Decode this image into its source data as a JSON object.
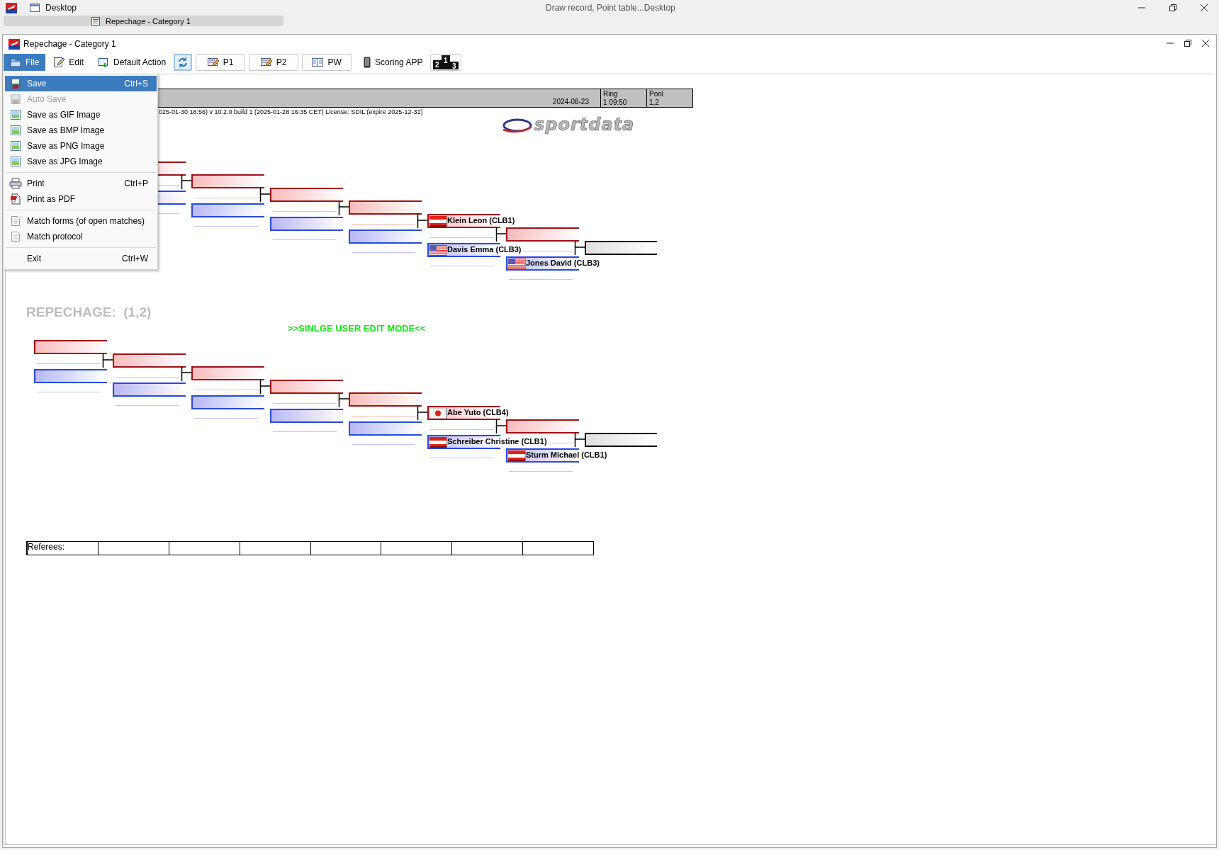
{
  "os_bar": {
    "desktop_label": "Desktop",
    "tab_label": "Repechage - Category 1",
    "center_title": "Draw record, Point table...Desktop"
  },
  "window": {
    "title": "Repechage - Category 1"
  },
  "toolbar": [
    {
      "kind": "menu",
      "label": "File",
      "selected": true
    },
    {
      "kind": "menu",
      "label": "Edit",
      "selected": false
    },
    {
      "kind": "menu",
      "label": "Default Action",
      "selected": false
    },
    {
      "kind": "icon-button",
      "selected": true
    },
    {
      "kind": "button",
      "label": "P1"
    },
    {
      "kind": "button",
      "label": "P2"
    },
    {
      "kind": "button",
      "label": "PW"
    },
    {
      "kind": "menu",
      "label": "Scoring APP",
      "selected": false
    },
    {
      "kind": "icon-button",
      "digits": [
        "2",
        "1",
        "3"
      ],
      "selected": false
    }
  ],
  "file_menu": [
    [
      {
        "label": "Save",
        "shortcut": "Ctrl+S",
        "selected": true,
        "disabled": false
      },
      {
        "label": "Auto Save",
        "selected": false,
        "disabled": true
      },
      {
        "label": "Save as GIF Image",
        "selected": false,
        "disabled": false
      },
      {
        "label": "Save as BMP Image",
        "selected": false,
        "disabled": false
      },
      {
        "label": "Save as PNG Image",
        "selected": false,
        "disabled": false
      },
      {
        "label": "Save as JPG Image",
        "selected": false,
        "disabled": false
      }
    ],
    [
      {
        "label": "Print",
        "shortcut": "Ctrl+P",
        "selected": false,
        "disabled": false
      },
      {
        "label": "Print as PDF",
        "selected": false,
        "disabled": false
      }
    ],
    [
      {
        "label": "Match forms (of open matches)",
        "selected": false,
        "disabled": false
      },
      {
        "label": "Match protocol",
        "selected": false,
        "disabled": false
      }
    ],
    [
      {
        "label": "Exit",
        "shortcut": "Ctrl+W",
        "selected": false,
        "disabled": false
      }
    ]
  ],
  "header": {
    "date": "2024-08-23",
    "ring_label": "Ring",
    "ring_value": "1 09:50",
    "pool_label": "Pool",
    "pool_value": "1,2"
  },
  "version_text": "025-01-30 18:56)  v 10.2.0 build 1 (2025-01-28 16:35 CET) License: SDIL (expire 2025-12-31)",
  "logo": "sportdata",
  "brackets": [
    {
      "rounds": [
        {
          "red": {
            "kind": "empty"
          },
          "blue": {
            "kind": "empty"
          }
        },
        {
          "red": {
            "kind": "empty"
          },
          "blue": {
            "kind": "empty"
          }
        },
        {
          "red": {
            "kind": "empty"
          },
          "blue": {
            "kind": "empty"
          }
        },
        {
          "red": {
            "kind": "empty"
          },
          "blue": {
            "kind": "empty"
          }
        },
        {
          "red": {
            "kind": "austria",
            "name": "Klein Leon (CLB1)"
          },
          "blue": {
            "kind": "usa",
            "name": "Davis Emma (CLB3)"
          }
        },
        {
          "red": {
            "kind": "empty"
          },
          "blue": {
            "kind": "usa",
            "name": "Jones David (CLB3)"
          }
        }
      ],
      "final": {
        "kind": "empty"
      }
    },
    {
      "title": "REPECHAGE:  (1,2)",
      "mode_notice": ">>SINLGE USER EDIT MODE<<",
      "rounds": [
        {
          "red": {
            "kind": "empty"
          },
          "blue": {
            "kind": "empty"
          }
        },
        {
          "red": {
            "kind": "empty"
          },
          "blue": {
            "kind": "empty"
          }
        },
        {
          "red": {
            "kind": "empty"
          },
          "blue": {
            "kind": "empty"
          }
        },
        {
          "red": {
            "kind": "empty"
          },
          "blue": {
            "kind": "empty"
          }
        },
        {
          "red": {
            "kind": "empty"
          },
          "blue": {
            "kind": "empty"
          }
        },
        {
          "red": {
            "kind": "japan",
            "name": "Abe Yuto (CLB4)"
          },
          "blue": {
            "kind": "austria",
            "name": "Schreiber Christine (CLB1)"
          }
        },
        {
          "red": {
            "kind": "empty"
          },
          "blue": {
            "kind": "austria",
            "name": "Sturm Michael (CLB1)"
          }
        }
      ],
      "final": {
        "kind": "empty"
      }
    }
  ],
  "referees": {
    "label": "Referees:"
  }
}
